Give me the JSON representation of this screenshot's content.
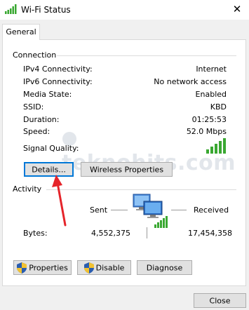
{
  "window": {
    "title": "Wi-Fi Status",
    "close_glyph": "✕"
  },
  "tabs": [
    {
      "label": "General",
      "active": true
    }
  ],
  "connection": {
    "group_label": "Connection",
    "rows": [
      {
        "label": "IPv4 Connectivity:",
        "value": "Internet"
      },
      {
        "label": "IPv6 Connectivity:",
        "value": "No network access"
      },
      {
        "label": "Media State:",
        "value": "Enabled"
      },
      {
        "label": "SSID:",
        "value": "KBD"
      },
      {
        "label": "Duration:",
        "value": "01:25:53"
      },
      {
        "label": "Speed:",
        "value": "52.0 Mbps"
      }
    ],
    "signal_quality_label": "Signal Quality:",
    "signal_bars_filled": 5,
    "signal_bars_total": 5,
    "details_button": "Details...",
    "wireless_properties_button": "Wireless Properties"
  },
  "activity": {
    "group_label": "Activity",
    "sent_label": "Sent",
    "received_label": "Received",
    "bytes_label": "Bytes:",
    "bytes_sent": "4,552,375",
    "bytes_received": "17,454,358"
  },
  "actions": {
    "properties_button": "Properties",
    "disable_button": "Disable",
    "diagnose_button": "Diagnose"
  },
  "footer": {
    "close_button": "Close"
  },
  "watermark": "teknohits.com",
  "colors": {
    "signal_green": "#3aa832",
    "focus_blue": "#0078d7",
    "annotation_red": "#e5242a"
  }
}
